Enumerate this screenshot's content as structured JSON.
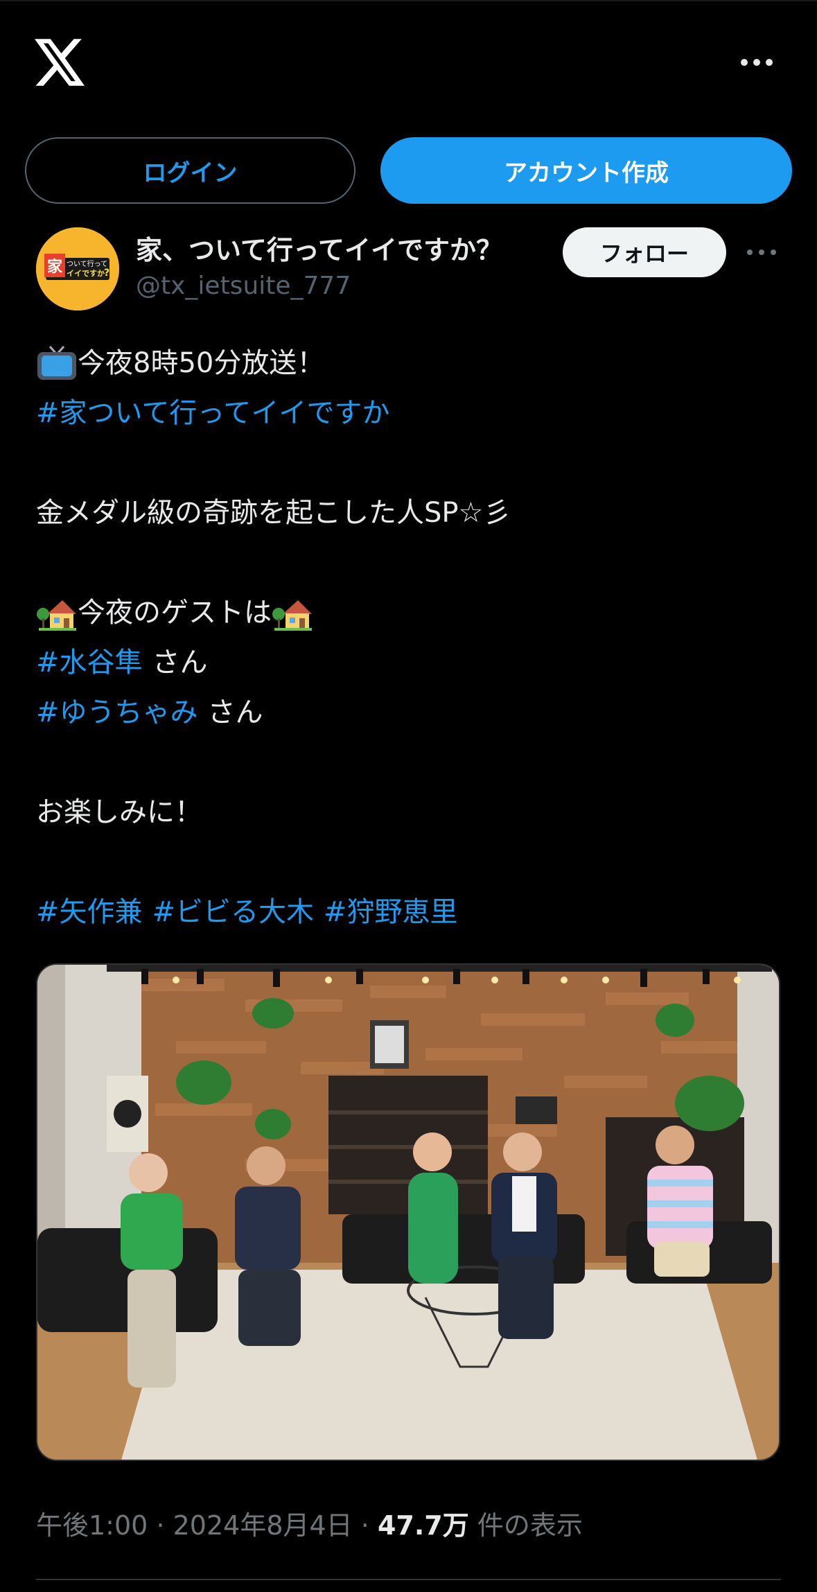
{
  "header": {
    "logo_icon": "x-logo-icon",
    "more_icon": "more-horizontal-icon"
  },
  "auth": {
    "login_label": "ログイン",
    "signup_label": "アカウント作成"
  },
  "author": {
    "display_name": "家、ついて行ってイイですか？",
    "handle": "@tx_ietsuite_777",
    "avatar_text": "家、ついて行ってイイですか",
    "follow_label": "フォロー"
  },
  "tweet": {
    "l1_text": "今夜8時50分放送！",
    "l2_tag": "#家ついて行ってイイですか",
    "l3_text": "金メダル級の奇跡を起こした人SP☆彡",
    "l4_text": "今夜のゲストは",
    "l5_tag": "#水谷隼",
    "l5_text": "さん",
    "l6_tag": "#ゆうちゃみ",
    "l6_text": "さん",
    "l7_text": "お楽しみに！",
    "l8_tag1": "#矢作兼",
    "l8_tag2": "#ビビる大木",
    "l8_tag3": "#狩野恵里"
  },
  "meta": {
    "time": "午後1:00",
    "date": "2024年8月4日",
    "views_count": "47.7万",
    "views_label": "件の表示",
    "separator": "·"
  },
  "colors": {
    "background": "#000000",
    "accent": "#1d9bf0",
    "text": "#e7e9ea",
    "muted": "#536471"
  }
}
